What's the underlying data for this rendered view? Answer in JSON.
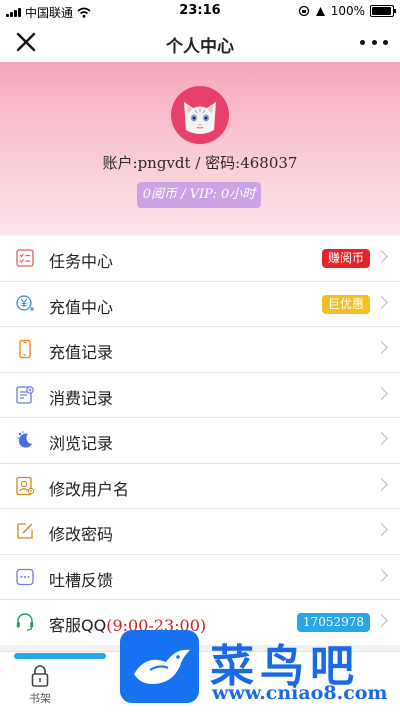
{
  "status_bar": {
    "carrier": "中国联通",
    "time": "23:16",
    "battery": "100%"
  },
  "nav": {
    "title": "个人中心"
  },
  "profile": {
    "account_line": "账户:pngvdt / 密码:468037",
    "balance_line": "0阅币 / VIP: 0小时"
  },
  "menu": {
    "items": [
      {
        "label": "任务中心",
        "tag": "赚阅币",
        "icon": "task-list-icon"
      },
      {
        "label": "充值中心",
        "tag": "巨优惠",
        "icon": "yuan-coin-icon"
      },
      {
        "label": "充值记录",
        "icon": "phone-icon"
      },
      {
        "label": "消费记录",
        "icon": "receipt-icon"
      },
      {
        "label": "浏览记录",
        "icon": "moon-stars-icon"
      },
      {
        "label": "修改用户名",
        "icon": "user-card-icon"
      },
      {
        "label": "修改密码",
        "icon": "edit-icon"
      },
      {
        "label": "吐槽反馈",
        "icon": "chat-bubble-icon"
      },
      {
        "label": "客服QQ",
        "hours": "(9:00-23:00)",
        "tag": "17052978",
        "icon": "headset-icon"
      }
    ]
  },
  "tab_bar": {
    "shelf_label": "书架"
  },
  "watermark": {
    "title": "菜鸟吧",
    "url": "www.cniao8.com"
  },
  "colors": {
    "tag_red": "#e0262d",
    "tag_yellow": "#f6c025",
    "tag_blue": "#27a6e8",
    "badge_purple": "#c9a3e3",
    "avatar_pink": "#e8406a"
  }
}
